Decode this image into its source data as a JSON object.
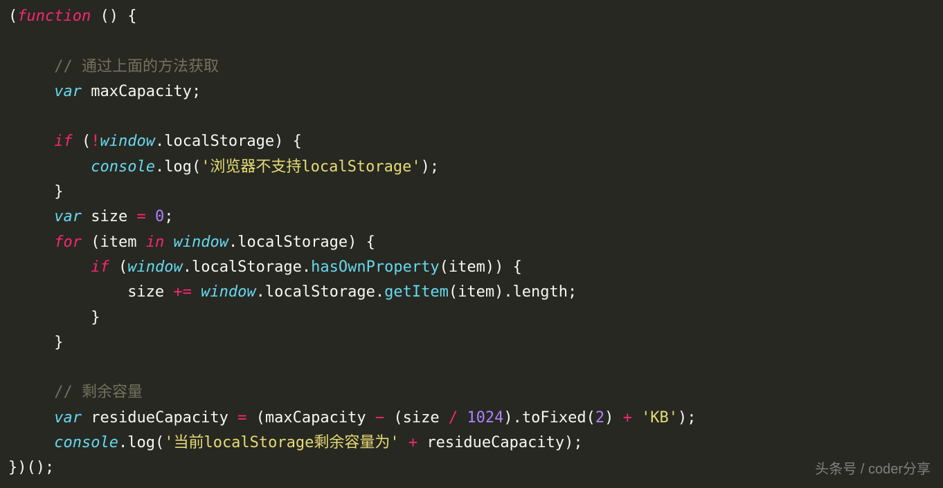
{
  "code": {
    "tokens": {
      "paren_open": "(",
      "paren_close": ")",
      "brace_open": "{",
      "brace_close": "}",
      "semicolon": ";",
      "comma": ",",
      "dot": ".",
      "bang": "!",
      "plus": "+",
      "minus": "−",
      "slash": "/",
      "eq": "=",
      "peq": "+=",
      "kw_function": "function",
      "kw_var": "var",
      "kw_if": "if",
      "kw_for": "for",
      "kw_in": "in",
      "id_maxCapacity": "maxCapacity",
      "id_window": "window",
      "id_localStorage": "localStorage",
      "id_console": "console",
      "id_log": "log",
      "id_size": "size",
      "id_item": "item",
      "id_hasOwnProperty": "hasOwnProperty",
      "id_getItem": "getItem",
      "id_length": "length",
      "id_toFixed": "toFixed",
      "id_residueCapacity": "residueCapacity",
      "num_0": "0",
      "num_2": "2",
      "num_1024": "1024",
      "str_noSupport": "'浏览器不支持localStorage'",
      "str_kb": "'KB'",
      "str_remaining": "'当前localStorage剩余容量为'",
      "comment_top": "// 通过上面的方法获取",
      "comment_remain": "// 剩余容量"
    }
  },
  "watermark": "头条号 / coder分享"
}
